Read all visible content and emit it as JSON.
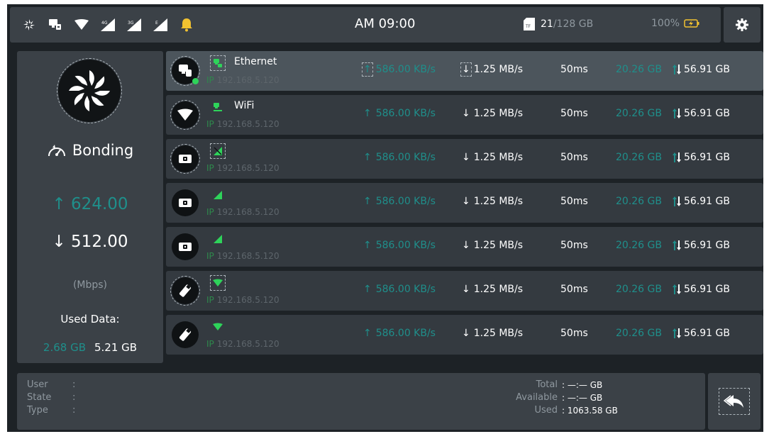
{
  "colors": {
    "accent": "#1f8f8b",
    "signal": "#2ed35a",
    "panel": "#3b4147",
    "row": "#343a40",
    "row_selected": "#4c555c",
    "bell": "#f2c230"
  },
  "statusbar": {
    "icons": [
      "fan-icon",
      "ethernet-icon",
      "wifi-icon",
      "signal-4g-icon",
      "signal-3g-icon",
      "signal-e-icon",
      "bell-icon"
    ],
    "network_labels": {
      "g4": "4G",
      "g3": "3G",
      "e": "E"
    },
    "time": "AM 09:00",
    "storage_card": "TF",
    "storage_used": "21",
    "storage_total": "/128 GB",
    "battery": "100%"
  },
  "bonding": {
    "label": "Bonding",
    "upload": "624.00",
    "download": "512.00",
    "unit": "(Mbps)",
    "used_label": "Used Data:",
    "used_up": "2.68 GB",
    "used_down": "5.21 GB"
  },
  "rows": [
    {
      "icon": "ethernet-icon",
      "name": "Ethernet",
      "ip_label": "IP",
      "ip": "192.168.5.120",
      "up": "586.00 KB/s",
      "down": "1.25 MB/s",
      "latency": "50ms",
      "tx": "20.26 GB",
      "rx": "56.91 GB"
    },
    {
      "icon": "wifi-icon",
      "name": "WiFi",
      "ip_label": "IP",
      "ip": "192.168.5.120",
      "up": "586.00 KB/s",
      "down": "1.25 MB/s",
      "latency": "50ms",
      "tx": "20.26 GB",
      "rx": "56.91 GB"
    },
    {
      "icon": "modem-icon",
      "name": "",
      "ip_label": "IP",
      "ip": "192.168.5.120",
      "up": "586.00 KB/s",
      "down": "1.25 MB/s",
      "latency": "50ms",
      "tx": "20.26 GB",
      "rx": "56.91 GB"
    },
    {
      "icon": "modem-icon",
      "name": "",
      "ip_label": "IP",
      "ip": "192.168.5.120",
      "up": "586.00 KB/s",
      "down": "1.25 MB/s",
      "latency": "50ms",
      "tx": "20.26 GB",
      "rx": "56.91 GB"
    },
    {
      "icon": "modem-icon",
      "name": "",
      "ip_label": "IP",
      "ip": "192.168.5.120",
      "up": "586.00 KB/s",
      "down": "1.25 MB/s",
      "latency": "50ms",
      "tx": "20.26 GB",
      "rx": "56.91 GB"
    },
    {
      "icon": "usb-dongle-icon",
      "name": "",
      "ip_label": "IP",
      "ip": "192.168.5.120",
      "up": "586.00 KB/s",
      "down": "1.25 MB/s",
      "latency": "50ms",
      "tx": "20.26 GB",
      "rx": "56.91 GB"
    },
    {
      "icon": "usb-dongle-icon",
      "name": "",
      "ip_label": "IP",
      "ip": "192.168.5.120",
      "up": "586.00 KB/s",
      "down": "1.25 MB/s",
      "latency": "50ms",
      "tx": "20.26 GB",
      "rx": "56.91 GB"
    }
  ],
  "info": {
    "user_label": "User",
    "state_label": "State",
    "type_label": "Type",
    "user_value": ":",
    "state_value": ":",
    "type_value": ":",
    "total_label": "Total",
    "available_label": "Available",
    "used_label": "Used",
    "total_value": ": —:— GB",
    "available_value": ": —:— GB",
    "used_value": ": 1063.58 GB"
  }
}
